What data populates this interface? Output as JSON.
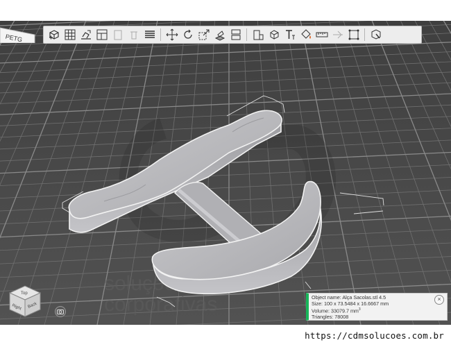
{
  "printer_tab": {
    "label": "PETG"
  },
  "toolbar": {
    "items": [
      {
        "name": "add-object",
        "label": "Add"
      },
      {
        "name": "arrange",
        "label": "Arrange"
      },
      {
        "name": "lay-on-face",
        "label": "Lay on face"
      },
      {
        "name": "copy",
        "label": "Copy"
      },
      {
        "name": "paste",
        "label": "Paste"
      },
      {
        "name": "delete",
        "label": "Delete"
      },
      {
        "name": "layers",
        "label": "Layers"
      },
      {
        "name": "move",
        "label": "Move"
      },
      {
        "name": "rotate",
        "label": "Rotate"
      },
      {
        "name": "scale",
        "label": "Scale"
      },
      {
        "name": "place-on-face",
        "label": "Place on face"
      },
      {
        "name": "split",
        "label": "Split"
      },
      {
        "name": "cut",
        "label": "Cut"
      },
      {
        "name": "support-paint",
        "label": "Support painting"
      },
      {
        "name": "seam-paint",
        "label": "Seam painting"
      },
      {
        "name": "text",
        "label": "Text"
      },
      {
        "name": "color-paint",
        "label": "Color painting"
      },
      {
        "name": "measure",
        "label": "Measure"
      },
      {
        "name": "assemble",
        "label": "Assemble"
      },
      {
        "name": "mesh-boolean",
        "label": "Mesh boolean"
      },
      {
        "name": "variable-layer",
        "label": "Variable layer height"
      }
    ]
  },
  "view_cube": {
    "top_label": "Top",
    "front_label": "Right",
    "side_label": "Back"
  },
  "object_info": {
    "name_line": "Object name: Alça Sacolas.stl 4.5",
    "size_line": "Size: 100 x 73.5484 x 16.6667 mm",
    "volume_line": "Volume: 33079.7 mm",
    "volume_unit_sup": "3",
    "triangles_line": "Triangles: 78008",
    "close_label": "×"
  },
  "watermark": {
    "line1": "soluções",
    "line2": "corporativas"
  },
  "footer": {
    "url": "https://cdmsolucoes.com.br"
  },
  "colors": {
    "bed": "#4a4a4a",
    "grid": "#6a6a6a",
    "object": "#b9b9bd",
    "accent_green": "#18b55a"
  }
}
